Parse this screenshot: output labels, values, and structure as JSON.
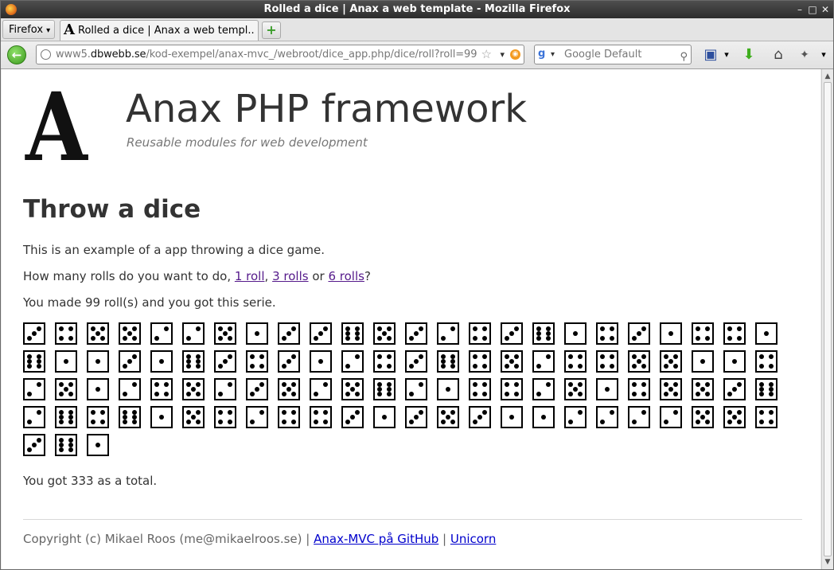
{
  "window": {
    "title": "Rolled a dice | Anax a web template - Mozilla Firefox"
  },
  "browser": {
    "menu_label": "Firefox",
    "tab_label": "Rolled a dice | Anax a web templ...",
    "new_tab": "+",
    "url_prefix": "www5.",
    "url_domain": "dbwebb.se",
    "url_path": "/kod-exempel/anax-mvc_/webroot/dice_app.php/dice/roll?roll=99",
    "search_placeholder": "Google Default"
  },
  "site": {
    "logo_letter": "A",
    "title": "Anax PHP framework",
    "slogan": "Reusable modules for web development"
  },
  "page": {
    "heading": "Throw a dice",
    "intro": "This is an example of a app throwing a dice game.",
    "question_prefix": "How many rolls do you want to do, ",
    "link_1": "1 roll",
    "sep_1": ", ",
    "link_3": "3 rolls",
    "sep_2": " or ",
    "link_6": "6 rolls",
    "question_suffix": "?",
    "result_text": "You made 99 roll(s) and you got this serie.",
    "total_text": "You got 333 as a total.",
    "dice_values": [
      3,
      4,
      5,
      5,
      2,
      2,
      5,
      1,
      3,
      3,
      6,
      5,
      3,
      2,
      4,
      3,
      6,
      1,
      4,
      3,
      1,
      4,
      4,
      1,
      6,
      1,
      1,
      3,
      1,
      6,
      3,
      4,
      3,
      1,
      2,
      4,
      3,
      6,
      4,
      5,
      2,
      4,
      4,
      5,
      5,
      1,
      1,
      4,
      2,
      5,
      1,
      2,
      4,
      5,
      2,
      3,
      5,
      2,
      5,
      6,
      2,
      1,
      4,
      4,
      2,
      5,
      1,
      4,
      5,
      5,
      3,
      6,
      2,
      6,
      4,
      6,
      1,
      5,
      4,
      2,
      4,
      4,
      3,
      1,
      3,
      5,
      3,
      1,
      1,
      2,
      2,
      2,
      2,
      5,
      5,
      4,
      3,
      6,
      1
    ]
  },
  "footer": {
    "copyright": "Copyright (c) Mikael Roos (me@mikaelroos.se) | ",
    "link_github": "Anax-MVC på GitHub",
    "sep": " | ",
    "link_unicorn": "Unicorn"
  }
}
